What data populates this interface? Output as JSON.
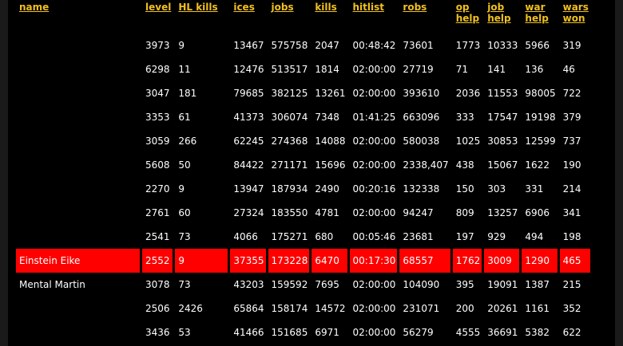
{
  "headers": [
    "name",
    "level",
    "HL kills",
    "ices",
    "jobs",
    "kills",
    "hitlist",
    "robs",
    "op help",
    "job help",
    "war help",
    "wars won"
  ],
  "rows": [
    {
      "highlight": false,
      "cells": [
        "",
        "3973",
        "9",
        "13467",
        "575758",
        "2047",
        "00:48:42",
        "73601",
        "1773",
        "10333",
        "5966",
        "319"
      ]
    },
    {
      "highlight": false,
      "cells": [
        "",
        "6298",
        "11",
        "12476",
        "513517",
        "1814",
        "02:00:00",
        "27719",
        "71",
        "141",
        "136",
        "46"
      ]
    },
    {
      "highlight": false,
      "cells": [
        "",
        "3047",
        "181",
        "79685",
        "382125",
        "13261",
        "02:00:00",
        "393610",
        "2036",
        "11553",
        "98005",
        "722"
      ]
    },
    {
      "highlight": false,
      "cells": [
        "",
        "3353",
        "61",
        "41373",
        "306074",
        "7348",
        "01:41:25",
        "663096",
        "333",
        "17547",
        "19198",
        "379"
      ]
    },
    {
      "highlight": false,
      "cells": [
        "",
        "3059",
        "266",
        "62245",
        "274368",
        "14088",
        "02:00:00",
        "580038",
        "1025",
        "30853",
        "12599",
        "737"
      ]
    },
    {
      "highlight": false,
      "cells": [
        "",
        "5608",
        "50",
        "84422",
        "271171",
        "15696",
        "02:00:00",
        "2338,407",
        "438",
        "15067",
        "1622",
        "190"
      ]
    },
    {
      "highlight": false,
      "cells": [
        "",
        "2270",
        "9",
        "13947",
        "187934",
        "2490",
        "00:20:16",
        "132338",
        "150",
        "303",
        "331",
        "214"
      ]
    },
    {
      "highlight": false,
      "cells": [
        "",
        "2761",
        "60",
        "27324",
        "183550",
        "4781",
        "02:00:00",
        "94247",
        "809",
        "13257",
        "6906",
        "341"
      ]
    },
    {
      "highlight": false,
      "cells": [
        "",
        "2541",
        "73",
        "4066",
        "175271",
        "680",
        "00:05:46",
        "23681",
        "197",
        "929",
        "494",
        "198"
      ]
    },
    {
      "highlight": true,
      "cells": [
        "Einstein Eike",
        "2552",
        "9",
        "37355",
        "173228",
        "6470",
        "00:17:30",
        "68557",
        "1762",
        "3009",
        "1290",
        "465"
      ]
    },
    {
      "highlight": false,
      "cells": [
        "Mental Martin",
        "3078",
        "73",
        "43203",
        "159592",
        "7695",
        "02:00:00",
        "104090",
        "395",
        "19091",
        "1387",
        "215"
      ]
    },
    {
      "highlight": false,
      "cells": [
        "",
        "2506",
        "2426",
        "65864",
        "158174",
        "14572",
        "02:00:00",
        "231071",
        "200",
        "20261",
        "1161",
        "352"
      ]
    },
    {
      "highlight": false,
      "cells": [
        "",
        "3436",
        "53",
        "41466",
        "151685",
        "6971",
        "02:00:00",
        "56279",
        "4555",
        "36691",
        "5382",
        "622"
      ]
    }
  ],
  "colors": {
    "background": "#000000",
    "header_link": "#f0c020",
    "highlight_row": "#ff0000",
    "text": "#ffffff"
  }
}
